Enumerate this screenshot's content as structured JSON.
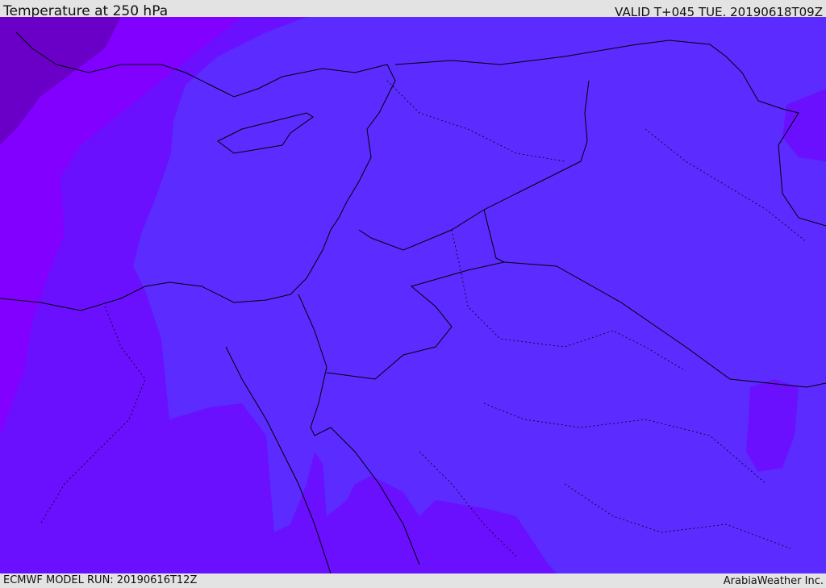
{
  "header": {
    "title": "Temperature at 250 hPa",
    "valid_time": "VALID T+045 TUE. 20190618T09Z"
  },
  "footer": {
    "model_run": "ECMWF MODEL RUN: 20190616T12Z",
    "credit": "ArabiaWeather Inc."
  },
  "map": {
    "variable": "temperature",
    "level_hpa": 250,
    "colors": {
      "base": "#5b2bff",
      "cool_band": "#6a10ff",
      "west_band": "#8200ff",
      "cold_core": "#6a00c8",
      "border_line": "#000000"
    }
  }
}
